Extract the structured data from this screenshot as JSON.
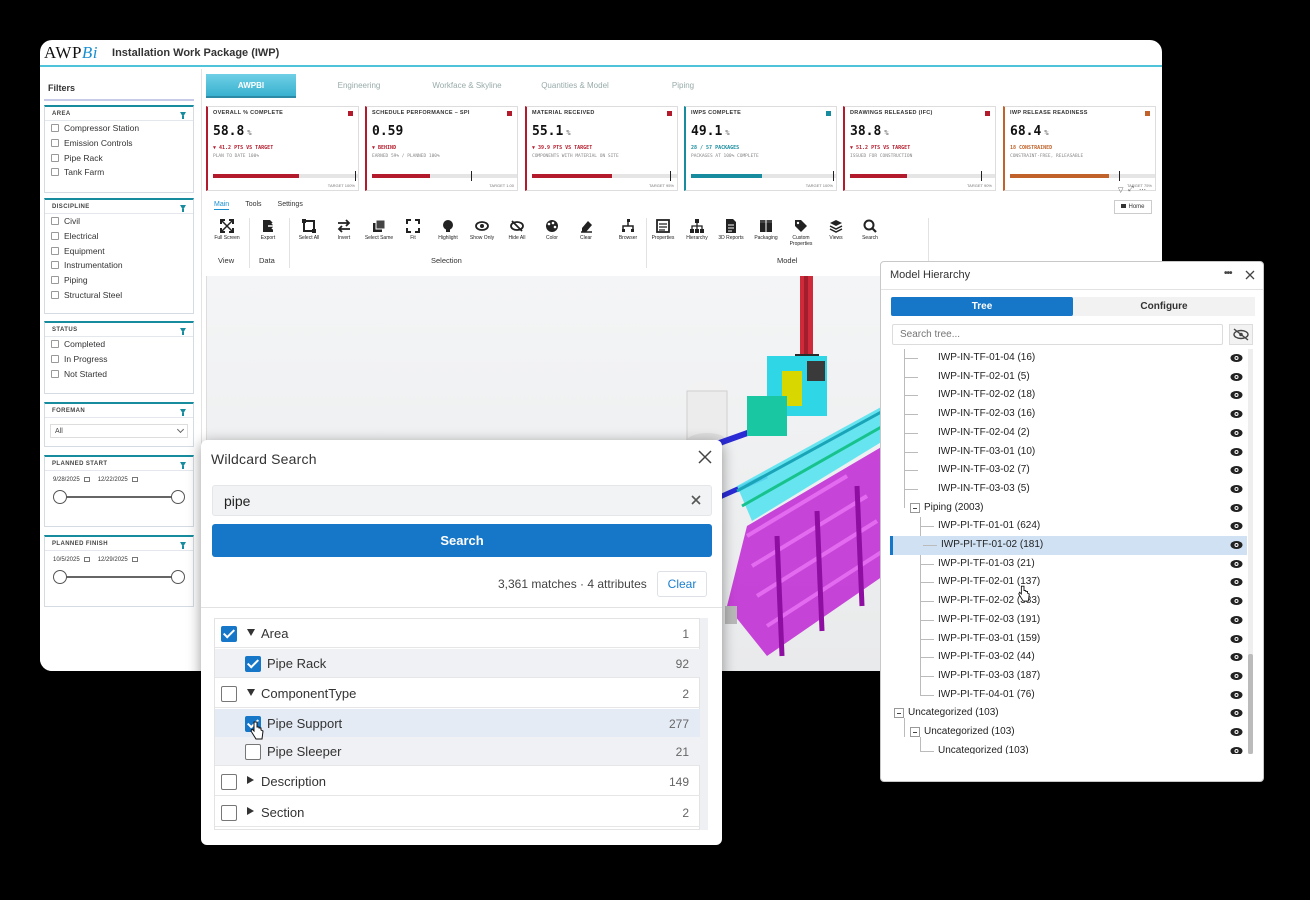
{
  "app": {
    "logo_main": "AWP",
    "logo_accent": "Bi",
    "title": "Installation Work Package (IWP)"
  },
  "filters": {
    "title": "Filters",
    "area": {
      "title": "AREA",
      "items": [
        "Compressor Station",
        "Emission Controls",
        "Pipe Rack",
        "Tank Farm"
      ]
    },
    "discipline": {
      "title": "DISCIPLINE",
      "items": [
        "Civil",
        "Electrical",
        "Equipment",
        "Instrumentation",
        "Piping",
        "Structural Steel"
      ]
    },
    "status": {
      "title": "STATUS",
      "items": [
        "Completed",
        "In Progress",
        "Not Started"
      ]
    },
    "foreman": {
      "title": "FOREMAN",
      "value": "All"
    },
    "planned_start": {
      "title": "PLANNED START",
      "from": "9/28/2025",
      "to": "12/22/2025"
    },
    "planned_finish": {
      "title": "PLANNED FINISH",
      "from": "10/5/2025",
      "to": "12/29/2025"
    }
  },
  "tabs": [
    "AWPBI",
    "Engineering",
    "Workface & Skyline",
    "Quantities & Model",
    "Piping"
  ],
  "kpis": [
    {
      "title": "OVERALL % COMPLETE",
      "value": "58.8",
      "unit": "%",
      "line1": "▼ 41.2 PTS VS TARGET",
      "line2": "PLAN TO DATE 100%",
      "target": "TARGET 100%",
      "color": "#b31b2c",
      "fill": 0.59,
      "marker": 0.98
    },
    {
      "title": "SCHEDULE PERFORMANCE – SPI",
      "value": "0.59",
      "unit": "",
      "line1": "▼ BEHIND",
      "line2": "EARNED 59% / PLANNED 100%",
      "target": "TARGET 1.00",
      "color": "#b31b2c",
      "fill": 0.4,
      "marker": 0.68
    },
    {
      "title": "MATERIAL RECEIVED",
      "value": "55.1",
      "unit": "%",
      "line1": "▼ 39.9 PTS VS TARGET",
      "line2": "COMPONENTS WITH MATERIAL ON SITE",
      "target": "TARGET 95%",
      "color": "#b31b2c",
      "fill": 0.55,
      "marker": 0.95
    },
    {
      "title": "IWPS COMPLETE",
      "value": "49.1",
      "unit": "%",
      "line1": "28 / 57 PACKAGES",
      "line2": "PACKAGES AT 100% COMPLETE",
      "target": "TARGET 100%",
      "color": "#178c9e",
      "fill": 0.49,
      "marker": 0.98
    },
    {
      "title": "DRAWINGS RELEASED (IFC)",
      "value": "38.8",
      "unit": "%",
      "line1": "▼ 51.2 PTS VS TARGET",
      "line2": "ISSUED FOR CONSTRUCTION",
      "target": "TARGET 90%",
      "color": "#b31b2c",
      "fill": 0.39,
      "marker": 0.9
    },
    {
      "title": "IWP RELEASE READINESS",
      "value": "68.4",
      "unit": "%",
      "line1": "18 CONSTRAINED",
      "line2": "CONSTRAINT-FREE, RELEASABLE",
      "target": "TARGET 75%",
      "color": "#c0622a",
      "fill": 0.68,
      "marker": 0.75
    }
  ],
  "ribbon": {
    "tabs": [
      "Main",
      "Tools",
      "Settings"
    ],
    "buttons": [
      {
        "label": "Full Screen",
        "icon": "fullscreen-icon"
      },
      {
        "label": "Export",
        "icon": "export-icon"
      },
      {
        "label": "Select All",
        "icon": "select-all-icon"
      },
      {
        "label": "Invert",
        "icon": "invert-icon"
      },
      {
        "label": "Select Same",
        "icon": "select-same-icon"
      },
      {
        "label": "Fit",
        "icon": "fit-icon"
      },
      {
        "label": "Highlight",
        "icon": "highlight-icon"
      },
      {
        "label": "Show Only",
        "icon": "show-only-icon"
      },
      {
        "label": "Hide All",
        "icon": "hide-all-icon"
      },
      {
        "label": "Color",
        "icon": "color-icon"
      },
      {
        "label": "Clear",
        "icon": "clear-icon"
      },
      {
        "label": "Browser",
        "icon": "browser-icon"
      },
      {
        "label": "Properties",
        "icon": "properties-icon"
      },
      {
        "label": "Hierarchy",
        "icon": "hierarchy-icon"
      },
      {
        "label": "3D Reports",
        "icon": "reports-icon"
      },
      {
        "label": "Packaging",
        "icon": "packaging-icon"
      },
      {
        "label": "Custom Properties",
        "icon": "tag-icon"
      },
      {
        "label": "Views",
        "icon": "views-icon"
      },
      {
        "label": "Search",
        "icon": "search-icon"
      }
    ],
    "groups": [
      "View",
      "Data",
      "Selection",
      "Model"
    ],
    "home": "Home"
  },
  "wildcard": {
    "title": "Wildcard Search",
    "query": "pipe",
    "search_label": "Search",
    "matches": "3,361 matches · 4 attributes",
    "clear_label": "Clear",
    "rows": [
      {
        "label": "Area",
        "count": "1",
        "checked": true,
        "expand": "down",
        "child": false
      },
      {
        "label": "Pipe Rack",
        "count": "92",
        "checked": true,
        "expand": "",
        "child": true
      },
      {
        "label": "ComponentType",
        "count": "2",
        "checked": false,
        "expand": "down",
        "child": false
      },
      {
        "label": "Pipe Support",
        "count": "277",
        "checked": true,
        "expand": "",
        "child": true
      },
      {
        "label": "Pipe Sleeper",
        "count": "21",
        "checked": false,
        "expand": "",
        "child": true
      },
      {
        "label": "Description",
        "count": "149",
        "checked": false,
        "expand": "right",
        "child": false
      },
      {
        "label": "Section",
        "count": "2",
        "checked": false,
        "expand": "right",
        "child": false
      }
    ]
  },
  "hierarchy": {
    "title": "Model Hierarchy",
    "tab_tree": "Tree",
    "tab_configure": "Configure",
    "search_placeholder": "Search tree...",
    "rows": [
      {
        "label": "IWP-IN-TF-01-04 (16)",
        "level": 2
      },
      {
        "label": "IWP-IN-TF-02-01 (5)",
        "level": 2
      },
      {
        "label": "IWP-IN-TF-02-02 (18)",
        "level": 2
      },
      {
        "label": "IWP-IN-TF-02-03 (16)",
        "level": 2
      },
      {
        "label": "IWP-IN-TF-02-04 (2)",
        "level": 2
      },
      {
        "label": "IWP-IN-TF-03-01 (10)",
        "level": 2
      },
      {
        "label": "IWP-IN-TF-03-02 (7)",
        "level": 2
      },
      {
        "label": "IWP-IN-TF-03-03 (5)",
        "level": 2
      },
      {
        "label": "Piping (2003)",
        "level": 1,
        "toggle": true
      },
      {
        "label": "IWP-PI-TF-01-01 (624)",
        "level": 2
      },
      {
        "label": "IWP-PI-TF-01-02 (181)",
        "level": 2,
        "selected": true
      },
      {
        "label": "IWP-PI-TF-01-03 (21)",
        "level": 2
      },
      {
        "label": "IWP-PI-TF-02-01 (137)",
        "level": 2
      },
      {
        "label": "IWP-PI-TF-02-02 (383)",
        "level": 2
      },
      {
        "label": "IWP-PI-TF-02-03 (191)",
        "level": 2
      },
      {
        "label": "IWP-PI-TF-03-01 (159)",
        "level": 2
      },
      {
        "label": "IWP-PI-TF-03-02 (44)",
        "level": 2
      },
      {
        "label": "IWP-PI-TF-03-03 (187)",
        "level": 2
      },
      {
        "label": "IWP-PI-TF-04-01 (76)",
        "level": 2
      },
      {
        "label": "Uncategorized (103)",
        "level": 0,
        "toggle": true
      },
      {
        "label": "Uncategorized (103)",
        "level": 1,
        "toggle": true
      },
      {
        "label": "Uncategorized (103)",
        "level": 2
      }
    ]
  },
  "colors": {
    "accent": "#1677c9",
    "teal": "#178c9e",
    "red": "#b31b2c",
    "magenta": "#c026d3",
    "cyan": "#2fd6e6",
    "blue": "#2b2bd6"
  }
}
